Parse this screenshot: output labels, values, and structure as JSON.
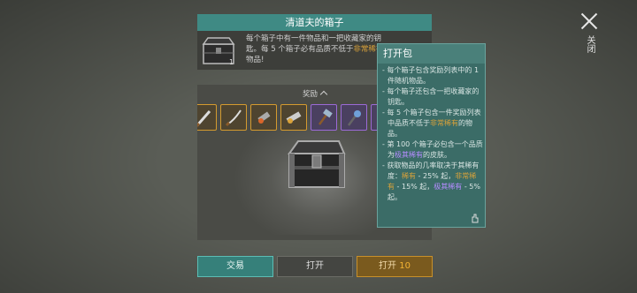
{
  "close": {
    "label": "关闭"
  },
  "chest": {
    "title": "清道夫的箱子",
    "key_count": "1",
    "desc_1": "每个箱子中有一件物品和一把收藏家的钥",
    "desc_2": "匙。每 5 个箱子必有品质不低于",
    "desc_rarity": "非常稀有",
    "desc_3": "物品!"
  },
  "rewards": {
    "header": "奖励",
    "slots": [
      {
        "icon": "machete-icon",
        "rarity": "orange"
      },
      {
        "icon": "sword-icon",
        "rarity": "orange"
      },
      {
        "icon": "flamethrower-icon",
        "rarity": "orange"
      },
      {
        "icon": "cannon-icon",
        "rarity": "orange"
      },
      {
        "icon": "hammer-icon",
        "rarity": "violet"
      },
      {
        "icon": "spiked-mace-icon",
        "rarity": "violet"
      }
    ]
  },
  "buttons": {
    "trade": "交易",
    "open": "打开",
    "open10_label": "打开",
    "open10_count": "10"
  },
  "tooltip": {
    "title": "打开包",
    "line1": "每个箱子包含奖励列表中的 1 件随机物品。",
    "line2": "每个箱子还包含一把收藏家的钥匙。",
    "line3_a": "每 5 个箱子包含一件奖励列表中品质不低于",
    "line3_b": "非常稀有",
    "line3_c": "的物品。",
    "line4_a": "第 100 个箱子必包含一个品质为",
    "line4_b": "极其稀有",
    "line4_c": "的皮肤。",
    "line5_a": "获取物品的几率取决于其稀有度：",
    "line5_b": "稀有",
    "line5_c": " - 25% 起，",
    "line5_d": "非常稀有",
    "line5_e": " - 15% 起，",
    "line5_f": "极其稀有",
    "line5_g": " - 5% 起。"
  },
  "colors": {
    "teal": "#3f8a84",
    "gold": "#d9a23a",
    "purple": "#b58cff"
  }
}
